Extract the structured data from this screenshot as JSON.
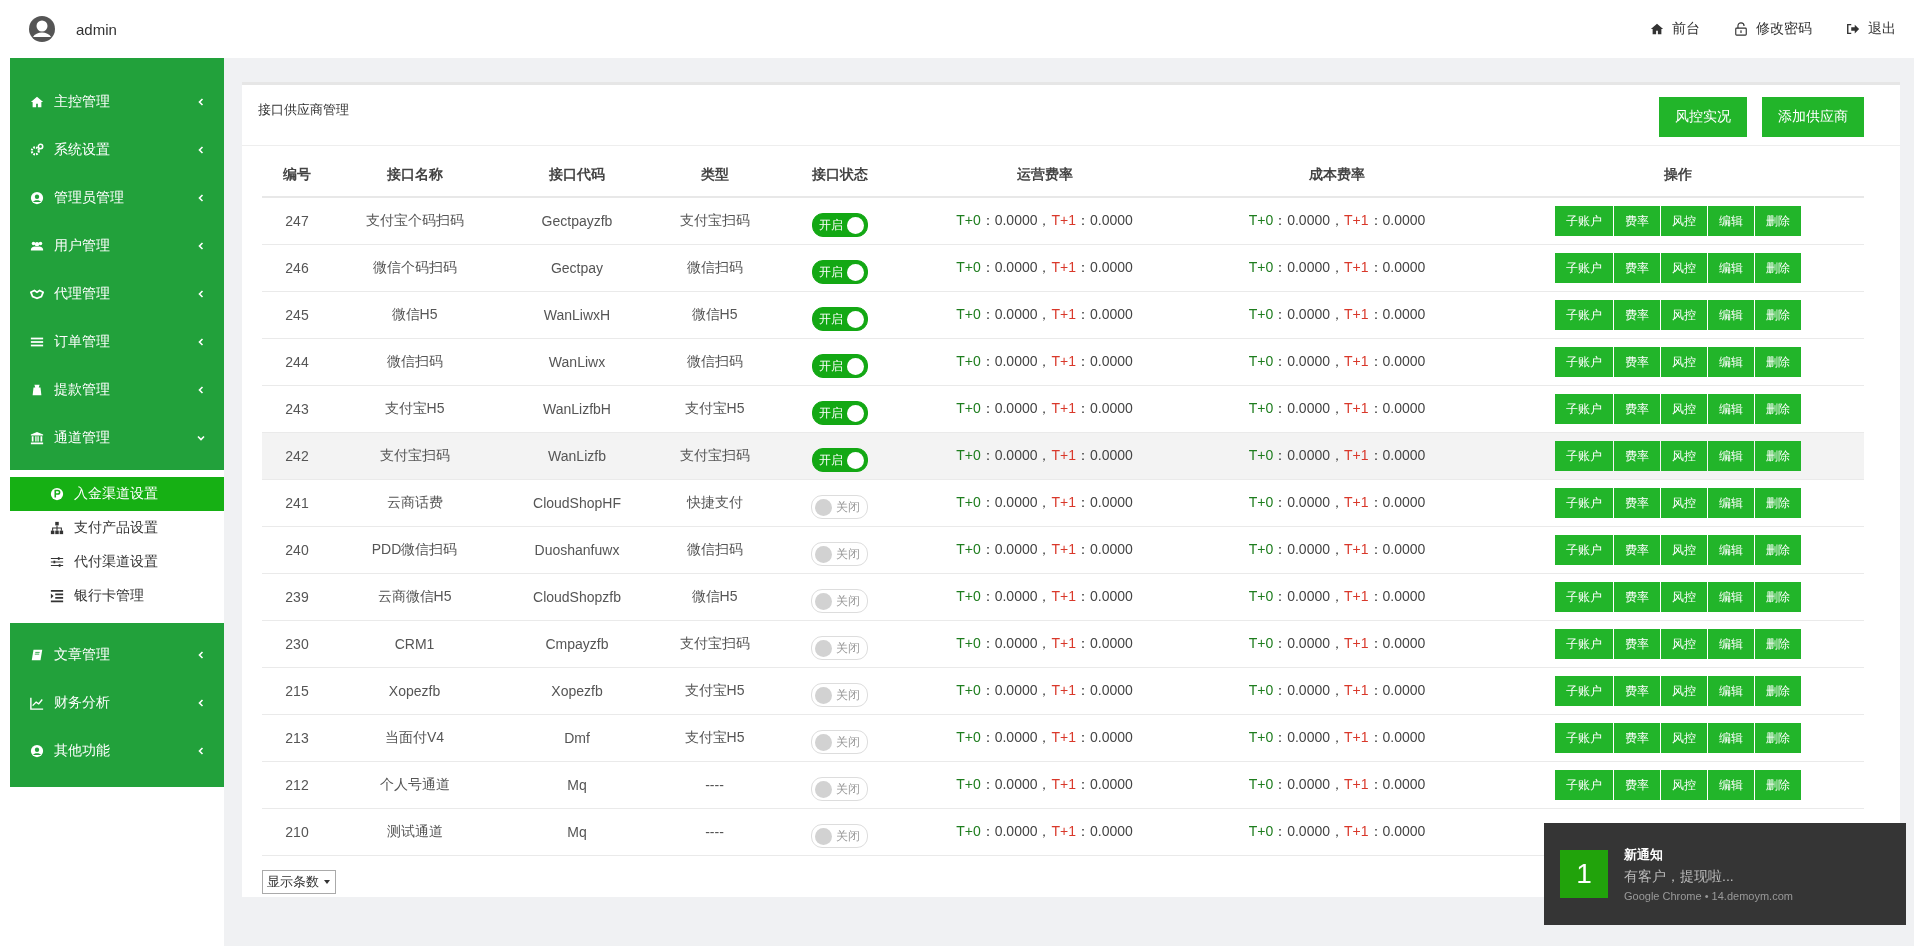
{
  "header": {
    "user": "admin",
    "links": [
      {
        "label": "前台"
      },
      {
        "label": "修改密码"
      },
      {
        "label": "退出"
      }
    ]
  },
  "sidebar": {
    "items": [
      {
        "label": "主控管理",
        "expanded": false
      },
      {
        "label": "系统设置",
        "expanded": false
      },
      {
        "label": "管理员管理",
        "expanded": false
      },
      {
        "label": "用户管理",
        "expanded": false
      },
      {
        "label": "代理管理",
        "expanded": false
      },
      {
        "label": "订单管理",
        "expanded": false
      },
      {
        "label": "提款管理",
        "expanded": false
      },
      {
        "label": "通道管理",
        "expanded": true,
        "children": [
          {
            "label": "入金渠道设置",
            "selected": true
          },
          {
            "label": "支付产品设置",
            "selected": false
          },
          {
            "label": "代付渠道设置",
            "selected": false
          },
          {
            "label": "银行卡管理",
            "selected": false
          }
        ]
      },
      {
        "label": "文章管理",
        "expanded": false
      },
      {
        "label": "财务分析",
        "expanded": false
      },
      {
        "label": "其他功能",
        "expanded": false
      }
    ]
  },
  "panel": {
    "title": "接口供应商管理",
    "buttons": [
      "风控实况",
      "添加供应商"
    ]
  },
  "table": {
    "columns": [
      "编号",
      "接口名称",
      "接口代码",
      "类型",
      "接口状态",
      "运营费率",
      "成本费率",
      "操作"
    ],
    "rows": [
      {
        "id": "247",
        "name": "支付宝个码扫码",
        "code": "Gectpayzfb",
        "type": "支付宝扫码",
        "status": {
          "on": true,
          "label": "开启"
        },
        "highlighted": false,
        "op_rate": [
          {
            "label": "T+0",
            "value": "：0.0000，"
          },
          {
            "label": "T+1",
            "value": "：0.0000"
          }
        ],
        "cost_rate": [
          {
            "label": "T+0",
            "value": "：0.0000，"
          },
          {
            "label": "T+1",
            "value": "：0.0000"
          }
        ],
        "actions": [
          "子账户",
          "费率",
          "风控",
          "编辑",
          "删除"
        ]
      },
      {
        "id": "246",
        "name": "微信个码扫码",
        "code": "Gectpay",
        "type": "微信扫码",
        "status": {
          "on": true,
          "label": "开启"
        },
        "highlighted": false,
        "op_rate": [
          {
            "label": "T+0",
            "value": "：0.0000，"
          },
          {
            "label": "T+1",
            "value": "：0.0000"
          }
        ],
        "cost_rate": [
          {
            "label": "T+0",
            "value": "：0.0000，"
          },
          {
            "label": "T+1",
            "value": "：0.0000"
          }
        ],
        "actions": [
          "子账户",
          "费率",
          "风控",
          "编辑",
          "删除"
        ]
      },
      {
        "id": "245",
        "name": "微信H5",
        "code": "WanLiwxH",
        "type": "微信H5",
        "status": {
          "on": true,
          "label": "开启"
        },
        "highlighted": false,
        "op_rate": [
          {
            "label": "T+0",
            "value": "：0.0000，"
          },
          {
            "label": "T+1",
            "value": "：0.0000"
          }
        ],
        "cost_rate": [
          {
            "label": "T+0",
            "value": "：0.0000，"
          },
          {
            "label": "T+1",
            "value": "：0.0000"
          }
        ],
        "actions": [
          "子账户",
          "费率",
          "风控",
          "编辑",
          "删除"
        ]
      },
      {
        "id": "244",
        "name": "微信扫码",
        "code": "WanLiwx",
        "type": "微信扫码",
        "status": {
          "on": true,
          "label": "开启"
        },
        "highlighted": false,
        "op_rate": [
          {
            "label": "T+0",
            "value": "：0.0000，"
          },
          {
            "label": "T+1",
            "value": "：0.0000"
          }
        ],
        "cost_rate": [
          {
            "label": "T+0",
            "value": "：0.0000，"
          },
          {
            "label": "T+1",
            "value": "：0.0000"
          }
        ],
        "actions": [
          "子账户",
          "费率",
          "风控",
          "编辑",
          "删除"
        ]
      },
      {
        "id": "243",
        "name": "支付宝H5",
        "code": "WanLizfbH",
        "type": "支付宝H5",
        "status": {
          "on": true,
          "label": "开启"
        },
        "highlighted": false,
        "op_rate": [
          {
            "label": "T+0",
            "value": "：0.0000，"
          },
          {
            "label": "T+1",
            "value": "：0.0000"
          }
        ],
        "cost_rate": [
          {
            "label": "T+0",
            "value": "：0.0000，"
          },
          {
            "label": "T+1",
            "value": "：0.0000"
          }
        ],
        "actions": [
          "子账户",
          "费率",
          "风控",
          "编辑",
          "删除"
        ]
      },
      {
        "id": "242",
        "name": "支付宝扫码",
        "code": "WanLizfb",
        "type": "支付宝扫码",
        "status": {
          "on": true,
          "label": "开启"
        },
        "highlighted": true,
        "op_rate": [
          {
            "label": "T+0",
            "value": "：0.0000，"
          },
          {
            "label": "T+1",
            "value": "：0.0000"
          }
        ],
        "cost_rate": [
          {
            "label": "T+0",
            "value": "：0.0000，"
          },
          {
            "label": "T+1",
            "value": "：0.0000"
          }
        ],
        "actions": [
          "子账户",
          "费率",
          "风控",
          "编辑",
          "删除"
        ]
      },
      {
        "id": "241",
        "name": "云商话费",
        "code": "CloudShopHF",
        "type": "快捷支付",
        "status": {
          "on": false,
          "label": "关闭"
        },
        "highlighted": false,
        "op_rate": [
          {
            "label": "T+0",
            "value": "：0.0000，"
          },
          {
            "label": "T+1",
            "value": "：0.0000"
          }
        ],
        "cost_rate": [
          {
            "label": "T+0",
            "value": "：0.0000，"
          },
          {
            "label": "T+1",
            "value": "：0.0000"
          }
        ],
        "actions": [
          "子账户",
          "费率",
          "风控",
          "编辑",
          "删除"
        ]
      },
      {
        "id": "240",
        "name": "PDD微信扫码",
        "code": "Duoshanfuwx",
        "type": "微信扫码",
        "status": {
          "on": false,
          "label": "关闭"
        },
        "highlighted": false,
        "op_rate": [
          {
            "label": "T+0",
            "value": "：0.0000，"
          },
          {
            "label": "T+1",
            "value": "：0.0000"
          }
        ],
        "cost_rate": [
          {
            "label": "T+0",
            "value": "：0.0000，"
          },
          {
            "label": "T+1",
            "value": "：0.0000"
          }
        ],
        "actions": [
          "子账户",
          "费率",
          "风控",
          "编辑",
          "删除"
        ]
      },
      {
        "id": "239",
        "name": "云商微信H5",
        "code": "CloudShopzfb",
        "type": "微信H5",
        "status": {
          "on": false,
          "label": "关闭"
        },
        "highlighted": false,
        "op_rate": [
          {
            "label": "T+0",
            "value": "：0.0000，"
          },
          {
            "label": "T+1",
            "value": "：0.0000"
          }
        ],
        "cost_rate": [
          {
            "label": "T+0",
            "value": "：0.0000，"
          },
          {
            "label": "T+1",
            "value": "：0.0000"
          }
        ],
        "actions": [
          "子账户",
          "费率",
          "风控",
          "编辑",
          "删除"
        ]
      },
      {
        "id": "230",
        "name": "CRM1",
        "code": "Cmpayzfb",
        "type": "支付宝扫码",
        "status": {
          "on": false,
          "label": "关闭"
        },
        "highlighted": false,
        "op_rate": [
          {
            "label": "T+0",
            "value": "：0.0000，"
          },
          {
            "label": "T+1",
            "value": "：0.0000"
          }
        ],
        "cost_rate": [
          {
            "label": "T+0",
            "value": "：0.0000，"
          },
          {
            "label": "T+1",
            "value": "：0.0000"
          }
        ],
        "actions": [
          "子账户",
          "费率",
          "风控",
          "编辑",
          "删除"
        ]
      },
      {
        "id": "215",
        "name": "Xopezfb",
        "code": "Xopezfb",
        "type": "支付宝H5",
        "status": {
          "on": false,
          "label": "关闭"
        },
        "highlighted": false,
        "op_rate": [
          {
            "label": "T+0",
            "value": "：0.0000，"
          },
          {
            "label": "T+1",
            "value": "：0.0000"
          }
        ],
        "cost_rate": [
          {
            "label": "T+0",
            "value": "：0.0000，"
          },
          {
            "label": "T+1",
            "value": "：0.0000"
          }
        ],
        "actions": [
          "子账户",
          "费率",
          "风控",
          "编辑",
          "删除"
        ]
      },
      {
        "id": "213",
        "name": "当面付V4",
        "code": "Dmf",
        "type": "支付宝H5",
        "status": {
          "on": false,
          "label": "关闭"
        },
        "highlighted": false,
        "op_rate": [
          {
            "label": "T+0",
            "value": "：0.0000，"
          },
          {
            "label": "T+1",
            "value": "：0.0000"
          }
        ],
        "cost_rate": [
          {
            "label": "T+0",
            "value": "：0.0000，"
          },
          {
            "label": "T+1",
            "value": "：0.0000"
          }
        ],
        "actions": [
          "子账户",
          "费率",
          "风控",
          "编辑",
          "删除"
        ]
      },
      {
        "id": "212",
        "name": "个人号通道",
        "code": "Mq",
        "type": "----",
        "status": {
          "on": false,
          "label": "关闭"
        },
        "highlighted": false,
        "op_rate": [
          {
            "label": "T+0",
            "value": "：0.0000，"
          },
          {
            "label": "T+1",
            "value": "：0.0000"
          }
        ],
        "cost_rate": [
          {
            "label": "T+0",
            "value": "：0.0000，"
          },
          {
            "label": "T+1",
            "value": "：0.0000"
          }
        ],
        "actions": [
          "子账户",
          "费率",
          "风控",
          "编辑",
          "删除"
        ]
      },
      {
        "id": "210",
        "name": "测试通道",
        "code": "Mq",
        "type": "----",
        "status": {
          "on": false,
          "label": "关闭"
        },
        "highlighted": false,
        "op_rate": [
          {
            "label": "T+0",
            "value": "：0.0000，"
          },
          {
            "label": "T+1",
            "value": "：0.0000"
          }
        ],
        "cost_rate": [
          {
            "label": "T+0",
            "value": "：0.0000，"
          },
          {
            "label": "T+1",
            "value": "：0.0000"
          }
        ]
      }
    ]
  },
  "page_size": {
    "label": "显示条数"
  },
  "notification": {
    "badge": "1",
    "title": "新通知",
    "message": "有客户，提现啦...",
    "source": "Google Chrome • 14.demoym.com"
  }
}
